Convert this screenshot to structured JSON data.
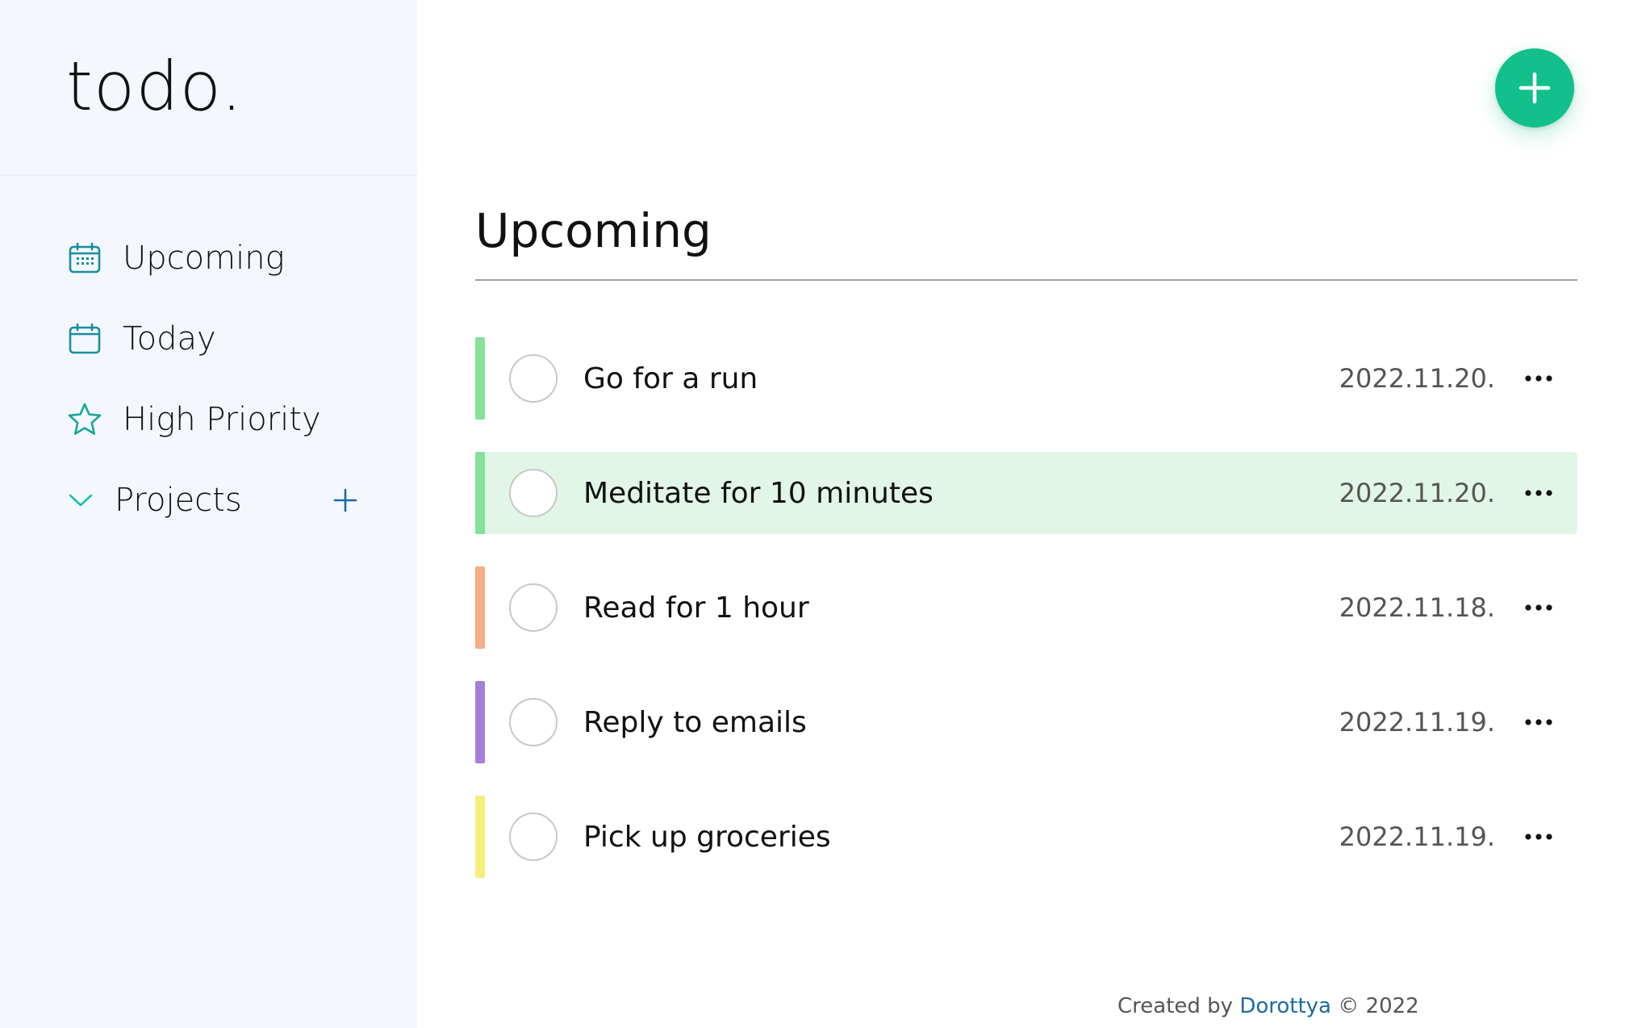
{
  "app": {
    "logo": "todo."
  },
  "sidebar": {
    "items": [
      {
        "label": "Upcoming",
        "icon": "calendar-grid-icon"
      },
      {
        "label": "Today",
        "icon": "calendar-icon"
      },
      {
        "label": "High Priority",
        "icon": "star-icon"
      }
    ],
    "projects": {
      "label": "Projects",
      "expand_icon": "chevron-down-icon",
      "add_icon": "plus-icon"
    }
  },
  "main": {
    "title": "Upcoming",
    "add_button_icon": "plus-icon",
    "tasks": [
      {
        "name": "Go for a run",
        "date": "2022.11.20.",
        "color": "#86e19a",
        "highlighted": false
      },
      {
        "name": "Meditate for 10 minutes",
        "date": "2022.11.20.",
        "color": "#86e19a",
        "highlighted": true
      },
      {
        "name": "Read for 1 hour",
        "date": "2022.11.18.",
        "color": "#f7ac85",
        "highlighted": false
      },
      {
        "name": "Reply to emails",
        "date": "2022.11.19.",
        "color": "#a37fdc",
        "highlighted": false
      },
      {
        "name": "Pick up groceries",
        "date": "2022.11.19.",
        "color": "#f5ee7a",
        "highlighted": false
      }
    ]
  },
  "footer": {
    "prefix": "Created by",
    "author": "Dorottya",
    "suffix": "© 2022"
  },
  "colors": {
    "accent": "#11c08a",
    "icon_teal": "#178ea0",
    "sidebar_bg": "#f4f7fe",
    "link": "#1b6aa3"
  }
}
